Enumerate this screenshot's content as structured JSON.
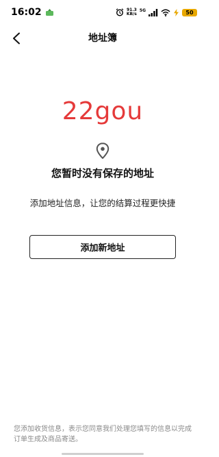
{
  "status_bar": {
    "time": "16:02",
    "net_speed_value": "91.3",
    "net_speed_unit": "KB/s",
    "network_type": "5G",
    "battery_level": "50"
  },
  "header": {
    "title": "地址簿"
  },
  "brand": {
    "logo_text": "22gou",
    "color": "#e53a3a"
  },
  "empty_state": {
    "icon": "location-pin-icon",
    "title": "您暂时没有保存的地址",
    "subtitle": "添加地址信息，让您的结算过程更快捷",
    "add_button_label": "添加新地址"
  },
  "footer": {
    "note": "您添加收货信息，表示您同意我们处理您填写的信息以完成订单生成及商品寄送。"
  }
}
